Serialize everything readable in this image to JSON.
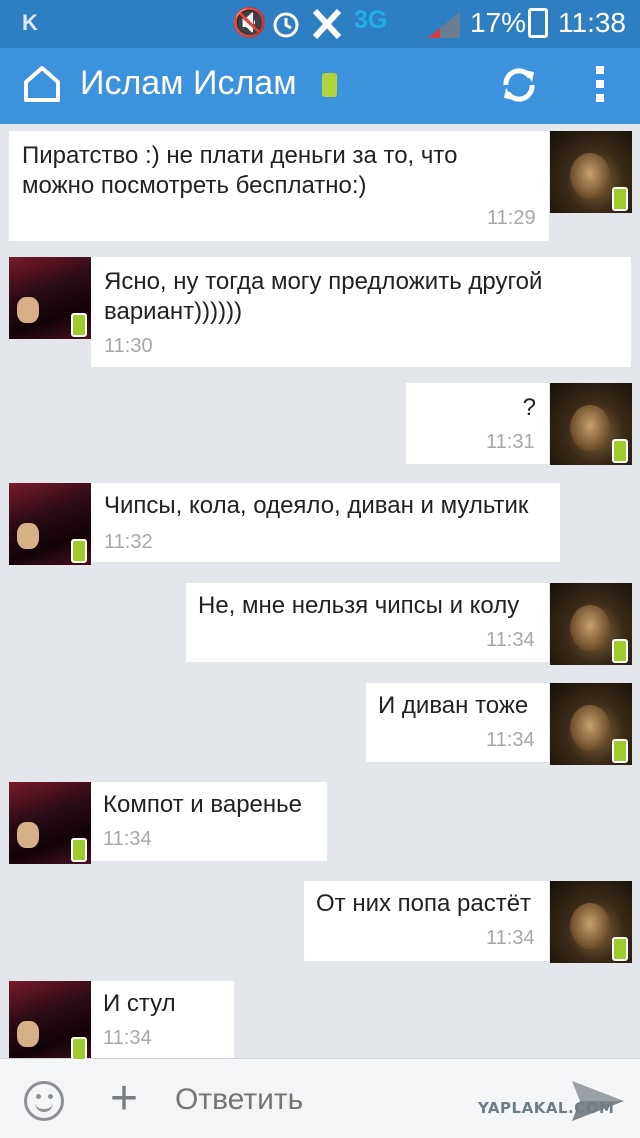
{
  "status_bar": {
    "left_icon": "K",
    "network": "3G",
    "battery_percent": "17%",
    "time": "11:38",
    "icons": [
      "k-notification-icon",
      "mute-icon",
      "alarm-icon",
      "x-app-icon",
      "signal-icon",
      "battery-icon"
    ]
  },
  "header": {
    "title": "Ислам Ислам",
    "icons": [
      "home-icon",
      "mobile-status-icon",
      "refresh-icon",
      "more-menu-icon"
    ]
  },
  "messages": [
    {
      "side": "self",
      "lines": [
        "Пиратство :) не плати деньги за то, что",
        "можно посмотреть бесплатно:)"
      ],
      "time": "11:29"
    },
    {
      "side": "other",
      "lines": [
        "Ясно, ну тогда могу предложить другой",
        "вариант))))))"
      ],
      "time": "11:30"
    },
    {
      "side": "self",
      "lines": [
        "?"
      ],
      "time": "11:31"
    },
    {
      "side": "other",
      "lines": [
        "Чипсы, кола, одеяло, диван и мультик"
      ],
      "time": "11:32"
    },
    {
      "side": "self",
      "lines": [
        "Не, мне нельзя чипсы и колу"
      ],
      "time": "11:34"
    },
    {
      "side": "self",
      "lines": [
        "И диван тоже"
      ],
      "time": "11:34"
    },
    {
      "side": "other",
      "lines": [
        "Компот и варенье"
      ],
      "time": "11:34"
    },
    {
      "side": "self",
      "lines": [
        "От них попа растёт"
      ],
      "time": "11:34"
    },
    {
      "side": "other",
      "lines": [
        "И стул"
      ],
      "time": "11:34"
    }
  ],
  "composer": {
    "placeholder": "Ответить",
    "icons": [
      "emoji-icon",
      "attach-plus-icon",
      "send-icon"
    ]
  },
  "watermark": "YAPLAKAL.COM",
  "colors": {
    "status_bar": "#2e7fc2",
    "app_bar": "#3c92dc",
    "background": "#e3e7ec",
    "mobile_badge": "#9fcb2c"
  }
}
